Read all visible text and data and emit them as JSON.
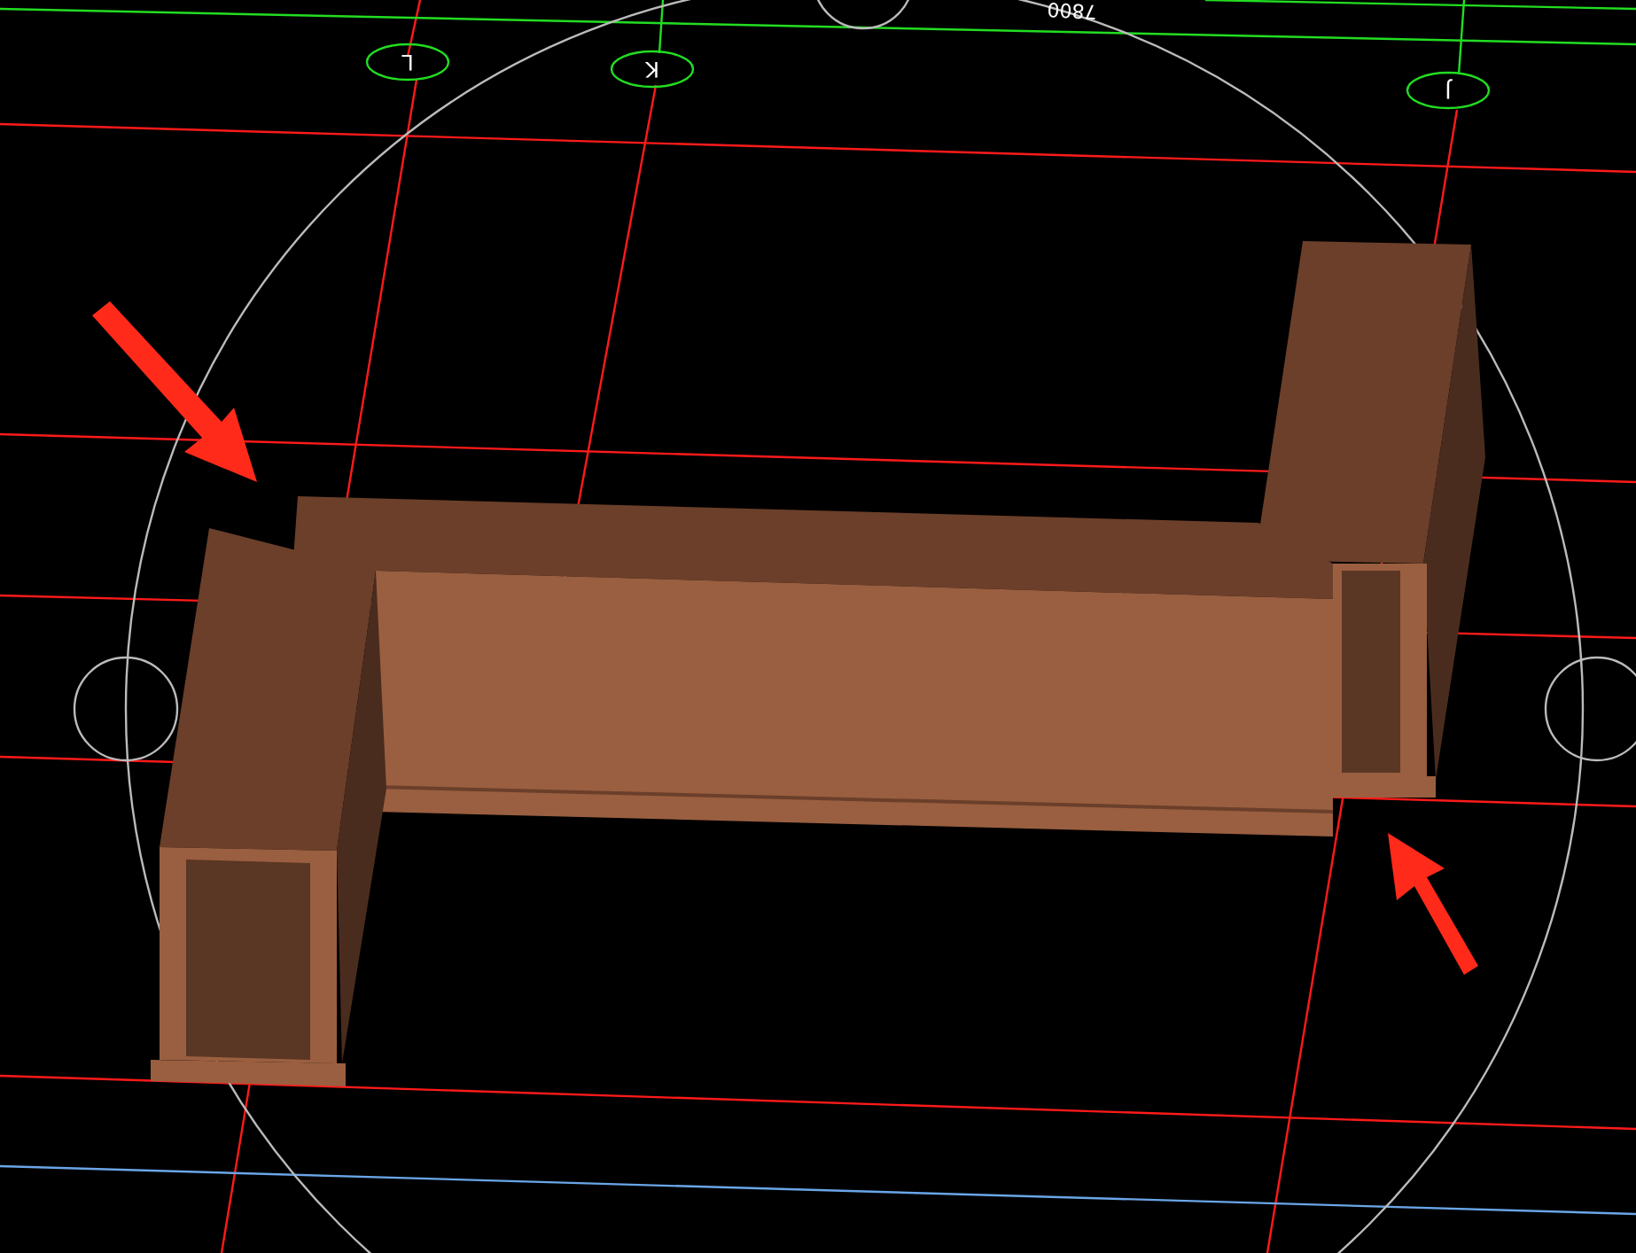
{
  "viewport": {
    "grid_labels": [
      {
        "text": "L"
      },
      {
        "text": "K"
      },
      {
        "text": "J"
      }
    ],
    "dimension_text": "7800"
  }
}
